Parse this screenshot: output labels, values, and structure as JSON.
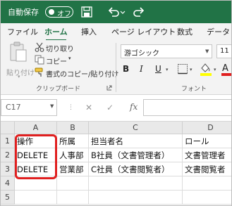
{
  "titlebar": {
    "autosave_label": "自動保存",
    "toggle_state": "オフ"
  },
  "tabs": [
    "ファイル",
    "ホーム",
    "挿入",
    "ページ レイアウト",
    "数式",
    "データ"
  ],
  "ribbon": {
    "paste_label": "貼り付け",
    "cut_label": "切り取り",
    "copy_label": "コピー",
    "format_painter_label": "書式のコピー/貼り付け",
    "clipboard_group": "クリップボード",
    "font_name": "游ゴシック",
    "font_size": "11",
    "bold": "B",
    "italic": "I",
    "underline": "U",
    "font_group": "フォント"
  },
  "formula_bar": {
    "cell_ref": "C17",
    "fx": "fx",
    "cancel": "✕",
    "enter": "✓"
  },
  "grid": {
    "columns": [
      "A",
      "B",
      "C",
      "D"
    ],
    "row_numbers": [
      "1",
      "2",
      "3",
      "4",
      "5"
    ],
    "rows": [
      [
        "操作",
        "所属",
        "担当者名",
        "ロール"
      ],
      [
        "DELETE",
        "人事部",
        "B社員（文書管理者）",
        "文書管理者"
      ],
      [
        "DELETE",
        "営業部",
        "C社員（文書閲覧者）",
        "文書閲覧者"
      ],
      [
        "",
        "",
        "",
        ""
      ],
      [
        "",
        "",
        "",
        ""
      ]
    ]
  },
  "colors": {
    "excel_green": "#217346",
    "highlight_red": "#e01f1f"
  }
}
